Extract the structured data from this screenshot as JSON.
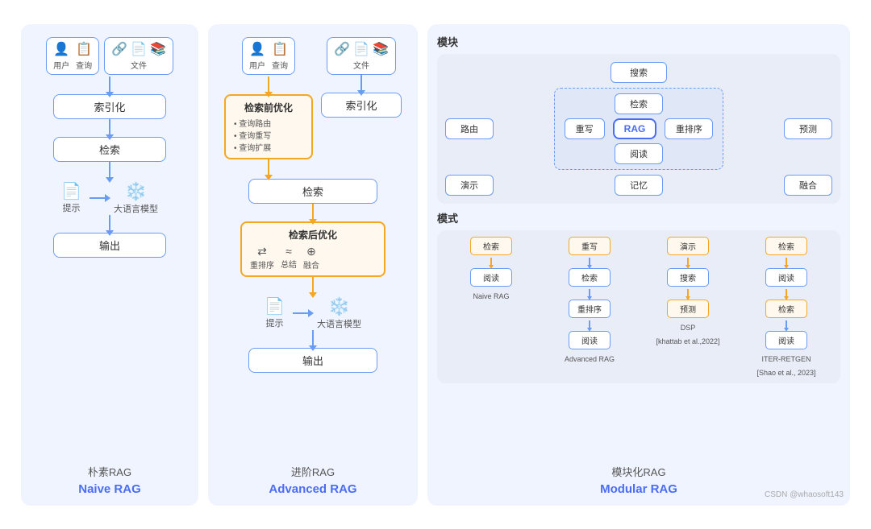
{
  "naive_rag": {
    "title_cn": "朴素RAG",
    "title_en": "Naive RAG",
    "input": {
      "user_label": "用户",
      "query_label": "查询",
      "file_label": "文件"
    },
    "nodes": {
      "index": "索引化",
      "search": "检索",
      "prompt": "提示",
      "llm": "大语言模型",
      "output": "输出"
    }
  },
  "advanced_rag": {
    "title_cn": "进阶RAG",
    "title_en": "Advanced RAG",
    "input": {
      "user_label": "用户",
      "query_label": "查询",
      "file_label": "文件"
    },
    "pre_opt": {
      "title": "检索前优化",
      "items": [
        "查询路由",
        "查询重写",
        "查询扩展"
      ]
    },
    "post_opt": {
      "title": "检索后优化",
      "items": [
        "重排序",
        "总结",
        "融合"
      ]
    },
    "nodes": {
      "index": "索引化",
      "search": "检索",
      "prompt": "提示",
      "llm": "大语言模型",
      "output": "输出"
    }
  },
  "modular_rag": {
    "title_cn": "模块化RAG",
    "title_en": "Modular RAG",
    "section_modules": "模块",
    "section_modes": "模式",
    "modules": {
      "search": "搜索",
      "route": "路由",
      "predict": "预测",
      "retrieve": "检索",
      "rewrite": "重写",
      "rag": "RAG",
      "rerank": "重排序",
      "read": "阅读",
      "demo": "演示",
      "memory": "记忆",
      "fuse": "融合"
    },
    "modes": [
      {
        "label_top": "Naive RAG",
        "nodes": [
          "检索",
          "阅读"
        ],
        "node_types": [
          "blue",
          "blue"
        ]
      },
      {
        "label_top": "Advanced RAG",
        "nodes": [
          "重写",
          "检索",
          "重排序",
          "阅读"
        ],
        "node_types": [
          "orange",
          "blue",
          "blue",
          "blue"
        ]
      },
      {
        "label_top": "DSP",
        "label_bottom": "[khattab et al.,2022]",
        "nodes": [
          "演示",
          "搜索",
          "预测"
        ],
        "node_types": [
          "orange",
          "blue",
          "orange"
        ]
      },
      {
        "label_top": "ITER-RETGEN",
        "label_bottom": "[Shao et al., 2023]",
        "nodes": [
          "检索",
          "阅读",
          "检索",
          "阅读"
        ],
        "node_types": [
          "orange",
          "blue",
          "orange",
          "blue"
        ]
      }
    ]
  },
  "watermark": "CSDN @whaosoft143"
}
